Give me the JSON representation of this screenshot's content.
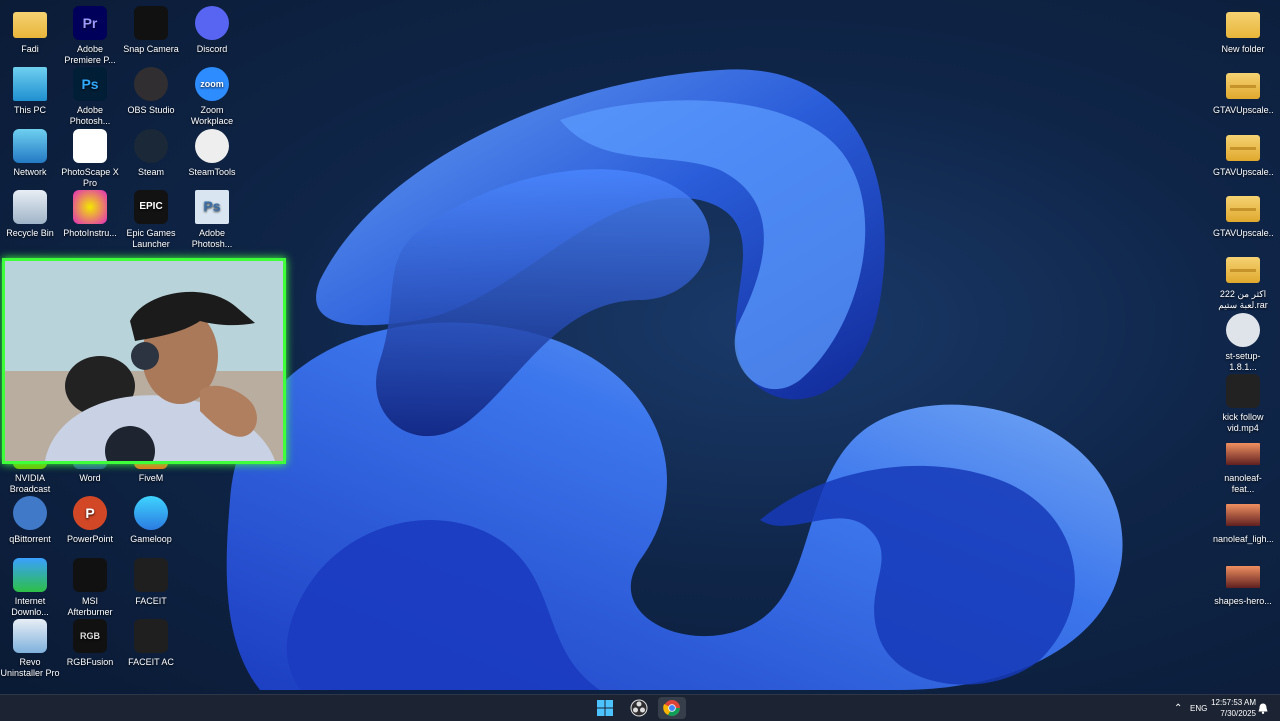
{
  "desktop": {
    "left_col1": [
      {
        "label": "Fadi",
        "icon": "user-folder-icon"
      },
      {
        "label": "This PC",
        "icon": "monitor-icon"
      },
      {
        "label": "Network",
        "icon": "network-icon"
      },
      {
        "label": "Recycle Bin",
        "icon": "recycle-bin-icon"
      },
      {
        "label": "NVIDIA Broadcast",
        "icon": "nvidia-icon"
      },
      {
        "label": "qBittorrent",
        "icon": "qbittorrent-icon"
      },
      {
        "label": "Internet Downlo...",
        "icon": "idm-icon"
      },
      {
        "label": "Revo Uninstaller Pro",
        "icon": "revo-icon"
      }
    ],
    "left_col2": [
      {
        "label": "Adobe Premiere P...",
        "icon": "premiere-icon",
        "glyph": "Pr"
      },
      {
        "label": "Adobe Photosh...",
        "icon": "photoshop-icon",
        "glyph": "Ps"
      },
      {
        "label": "PhotoScape X Pro",
        "icon": "photoscape-icon"
      },
      {
        "label": "PhotoInstru...",
        "icon": "photoinstrument-icon"
      },
      {
        "label": "Word",
        "icon": "word-icon"
      },
      {
        "label": "PowerPoint",
        "icon": "powerpoint-icon",
        "glyph": "P"
      },
      {
        "label": "MSI Afterburner",
        "icon": "msi-afterburner-icon"
      },
      {
        "label": "RGBFusion",
        "icon": "rgbfusion-icon",
        "glyph": "RGB"
      }
    ],
    "left_col3": [
      {
        "label": "Snap Camera",
        "icon": "snap-camera-icon"
      },
      {
        "label": "OBS Studio",
        "icon": "obs-icon"
      },
      {
        "label": "Steam",
        "icon": "steam-icon"
      },
      {
        "label": "Epic Games Launcher",
        "icon": "epic-games-icon",
        "glyph": "EPIC"
      },
      {
        "label": "FiveM",
        "icon": "fivem-icon"
      },
      {
        "label": "Gameloop",
        "icon": "gameloop-icon"
      },
      {
        "label": "FACEIT",
        "icon": "faceit-icon"
      },
      {
        "label": "FACEIT AC",
        "icon": "faceit-ac-icon"
      }
    ],
    "left_col4": [
      {
        "label": "Discord",
        "icon": "discord-icon"
      },
      {
        "label": "Zoom Workplace",
        "icon": "zoom-icon",
        "glyph": "zoom"
      },
      {
        "label": "SteamTools",
        "icon": "steamtools-icon"
      },
      {
        "label": "Adobe Photosh...",
        "icon": "photoshop-file-icon",
        "glyph": "Ps"
      }
    ],
    "right_col": [
      {
        "label": "New folder",
        "icon": "folder-icon"
      },
      {
        "label": "GTAVUpscale...",
        "icon": "zip-folder-icon"
      },
      {
        "label": "GTAVUpscale...",
        "icon": "zip-folder-icon"
      },
      {
        "label": "GTAVUpscale...",
        "icon": "zip-folder-icon"
      },
      {
        "label": "اكثر من 222 لعبة ستيم.rar",
        "icon": "rar-icon"
      },
      {
        "label": "st-setup-1.8.1...",
        "icon": "steam-setup-icon"
      },
      {
        "label": "kick follow vid.mp4",
        "icon": "video-file-icon"
      },
      {
        "label": "nanoleaf-feat...",
        "icon": "image-file-icon"
      },
      {
        "label": "nanoleaf_ligh...",
        "icon": "image-file-icon"
      },
      {
        "label": "shapes-hero...",
        "icon": "image-file-icon"
      }
    ]
  },
  "taskbar": {
    "language": "ENG",
    "time": "12:57:53 AM",
    "date": "7/30/2025"
  },
  "colors": {
    "webcam_border": "#3fff3a",
    "taskbar_bg": "#1c2433"
  }
}
